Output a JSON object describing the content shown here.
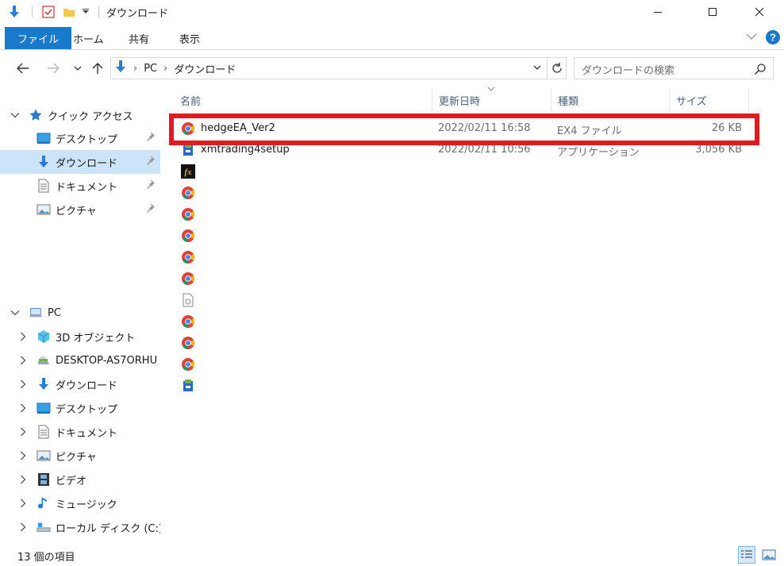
{
  "window": {
    "title": "ダウンロード"
  },
  "ribbon": {
    "tabs": [
      {
        "label": "ファイル",
        "active": true
      },
      {
        "label": "ホーム"
      },
      {
        "label": "共有"
      },
      {
        "label": "表示"
      }
    ]
  },
  "address": {
    "parts": [
      "PC",
      "ダウンロード"
    ],
    "search_placeholder": "ダウンロードの検索"
  },
  "nav": {
    "quick_access": "クイック アクセス",
    "quick_items": [
      {
        "label": "デスクトップ",
        "icon": "desktop-icon"
      },
      {
        "label": "ダウンロード",
        "icon": "download-icon",
        "selected": true
      },
      {
        "label": "ドキュメント",
        "icon": "document-icon"
      },
      {
        "label": "ピクチャ",
        "icon": "picture-icon"
      }
    ],
    "pc": "PC",
    "pc_items": [
      {
        "label": "3D オブジェクト",
        "icon": "3d-objects-icon"
      },
      {
        "label": "DESKTOP-AS7ORHU",
        "icon": "network-pc-icon"
      },
      {
        "label": "ダウンロード",
        "icon": "download-icon"
      },
      {
        "label": "デスクトップ",
        "icon": "desktop-icon"
      },
      {
        "label": "ドキュメント",
        "icon": "document-icon"
      },
      {
        "label": "ピクチャ",
        "icon": "picture-icon"
      },
      {
        "label": "ビデオ",
        "icon": "video-icon"
      },
      {
        "label": "ミュージック",
        "icon": "music-icon"
      },
      {
        "label": "ローカル ディスク (C:)",
        "icon": "local-disk-icon"
      }
    ]
  },
  "columns": {
    "name": "名前",
    "date": "更新日時",
    "type": "種類",
    "size": "サイズ"
  },
  "files": [
    {
      "name": "hedgeEA_Ver2",
      "date": "2022/02/11 16:58",
      "type": "EX4 ファイル",
      "size": "26 KB",
      "icon": "chrome-icon"
    },
    {
      "name": "xmtrading4setup",
      "date": "2022/02/11 10:56",
      "type": "アプリケーション",
      "size": "3,056 KB",
      "icon": "installer-icon"
    },
    {
      "name": "",
      "date": "",
      "type": "",
      "size": "",
      "icon": "fx-icon"
    },
    {
      "name": "",
      "date": "",
      "type": "",
      "size": "",
      "icon": "chrome-icon"
    },
    {
      "name": "",
      "date": "",
      "type": "",
      "size": "",
      "icon": "chrome-icon"
    },
    {
      "name": "",
      "date": "",
      "type": "",
      "size": "",
      "icon": "chrome-icon"
    },
    {
      "name": "",
      "date": "",
      "type": "",
      "size": "",
      "icon": "chrome-icon"
    },
    {
      "name": "",
      "date": "",
      "type": "",
      "size": "",
      "icon": "chrome-icon"
    },
    {
      "name": "",
      "date": "",
      "type": "",
      "size": "",
      "icon": "generic-file-icon"
    },
    {
      "name": "",
      "date": "",
      "type": "",
      "size": "",
      "icon": "chrome-icon"
    },
    {
      "name": "",
      "date": "",
      "type": "",
      "size": "",
      "icon": "chrome-icon"
    },
    {
      "name": "",
      "date": "",
      "type": "",
      "size": "",
      "icon": "chrome-icon"
    },
    {
      "name": "",
      "date": "",
      "type": "",
      "size": "",
      "icon": "installer-icon"
    }
  ],
  "status": {
    "item_count": "13 個の項目"
  },
  "colors": {
    "accent": "#1979ca",
    "selection": "#cce4f7",
    "highlight_box": "#e11b22"
  }
}
